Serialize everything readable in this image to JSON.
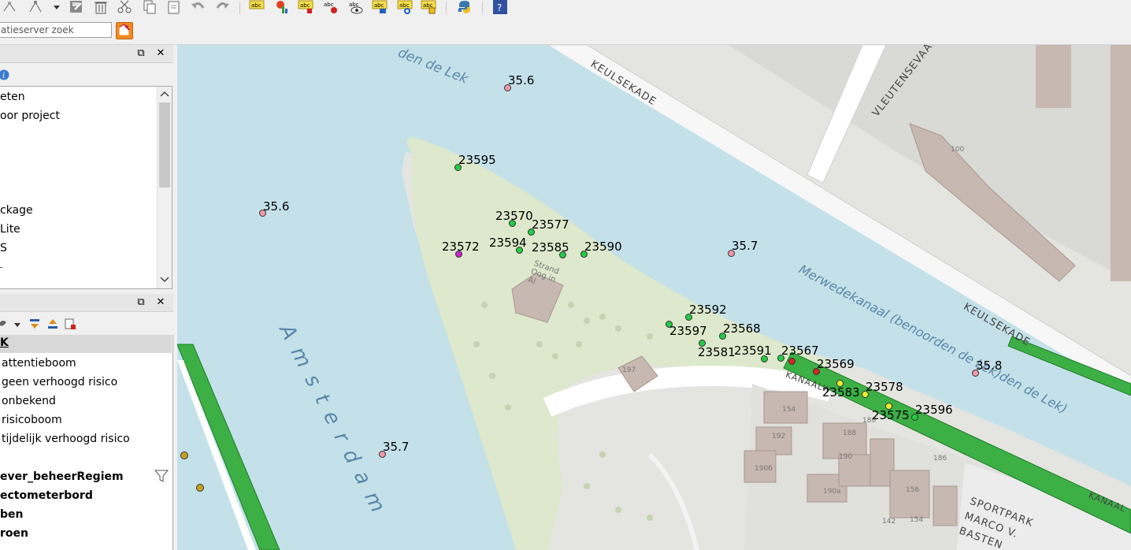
{
  "toolbar": {
    "icons": [
      "node-tool-icon",
      "vertex-tool-icon",
      "dropdown-arrow-icon",
      "save-edits-icon",
      "delete-icon",
      "cut-icon",
      "copy-icon",
      "paste-icon",
      "undo-icon",
      "redo-icon",
      "label-abc-icon",
      "diagram-icon",
      "label-abc-pin-icon",
      "label-abc-red-icon",
      "label-abc-eye-icon",
      "label-abc-move-icon",
      "label-abc-rotate-icon",
      "label-abc-change-icon",
      "python-icon",
      "help-icon"
    ]
  },
  "search": {
    "placeholder": "atieserver zoek"
  },
  "browser_panel": {
    "items": [
      "eten",
      "oor project",
      "",
      "",
      "",
      "ckage",
      "Lite",
      "S",
      ""
    ]
  },
  "layers_panel": {
    "header": "K",
    "items": [
      {
        "label": "attentieboom",
        "bold": false
      },
      {
        "label": "geen verhoogd risico",
        "bold": false
      },
      {
        "label": "onbekend",
        "bold": false
      },
      {
        "label": "risicoboom",
        "bold": false
      },
      {
        "label": "tijdelijk verhoogd risico",
        "bold": false
      },
      {
        "label": "",
        "bold": false
      },
      {
        "label": "ever_beheerRegiem",
        "bold": true
      },
      {
        "label": "ectometerbord",
        "bold": true
      },
      {
        "label": "ben",
        "bold": true
      },
      {
        "label": "roen",
        "bold": true
      }
    ]
  },
  "map": {
    "colors": {
      "water": "#c4e1ea",
      "park": "#dde8cc",
      "road": "#ffffff",
      "green_strip": "#3cb045",
      "building": "#c8b8b2",
      "land": "#e4e4e0"
    },
    "water_labels": [
      "den de Lek",
      "Amsterdam",
      "Merwedekanaal (benoorden de Lek)den de Lek)"
    ],
    "street_labels": [
      "KEULSEKADE",
      "VLEUTENSEVAART",
      "KEULSEKADE",
      "KANAALW",
      "KANAAL",
      "SPORTPARK MARCO V. BASTEN"
    ],
    "building_numbers": [
      "100",
      "197",
      "154",
      "192",
      "190",
      "188",
      "186",
      "1906",
      "190a",
      "186",
      "156",
      "154",
      "142"
    ],
    "park_label": "Strand Oog in Al",
    "depth_points": [
      {
        "label": "35.6",
        "color": "#ee9aa8"
      },
      {
        "label": "35.6",
        "color": "#ee9aa8"
      },
      {
        "label": "35.7",
        "color": "#ee9aa8"
      },
      {
        "label": "35.7",
        "color": "#ee9aa8"
      },
      {
        "label": "35.8",
        "color": "#ee9aa8"
      }
    ],
    "trees": [
      {
        "id": "23595",
        "status": "geen verhoogd risico",
        "color": "#22cc44"
      },
      {
        "id": "23570",
        "status": "geen verhoogd risico",
        "color": "#22cc44"
      },
      {
        "id": "23577",
        "status": "geen verhoogd risico",
        "color": "#22cc44"
      },
      {
        "id": "23594",
        "status": "geen verhoogd risico",
        "color": "#22cc44"
      },
      {
        "id": "23585",
        "status": "geen verhoogd risico",
        "color": "#22cc44"
      },
      {
        "id": "23590",
        "status": "geen verhoogd risico",
        "color": "#22cc44"
      },
      {
        "id": "23572",
        "status": "onbekend",
        "color": "#cc22cc"
      },
      {
        "id": "23592",
        "status": "geen verhoogd risico",
        "color": "#22cc44"
      },
      {
        "id": "23597",
        "status": "geen verhoogd risico",
        "color": "#22cc44"
      },
      {
        "id": "23568",
        "status": "geen verhoogd risico",
        "color": "#22cc44"
      },
      {
        "id": "23581",
        "status": "geen verhoogd risico",
        "color": "#22cc44"
      },
      {
        "id": "23591",
        "status": "geen verhoogd risico",
        "color": "#22cc44"
      },
      {
        "id": "23567",
        "status": "risicoboom",
        "color": "#dd2222"
      },
      {
        "id": "23569",
        "status": "risicoboom",
        "color": "#dd2222"
      },
      {
        "id": "23583",
        "status": "attentieboom",
        "color": "#eeee33"
      },
      {
        "id": "23578",
        "status": "attentieboom",
        "color": "#eeee33"
      },
      {
        "id": "23575",
        "status": "attentieboom",
        "color": "#eeee33"
      },
      {
        "id": "23596",
        "status": "geen verhoogd risico",
        "color": "#22cc44"
      }
    ]
  }
}
